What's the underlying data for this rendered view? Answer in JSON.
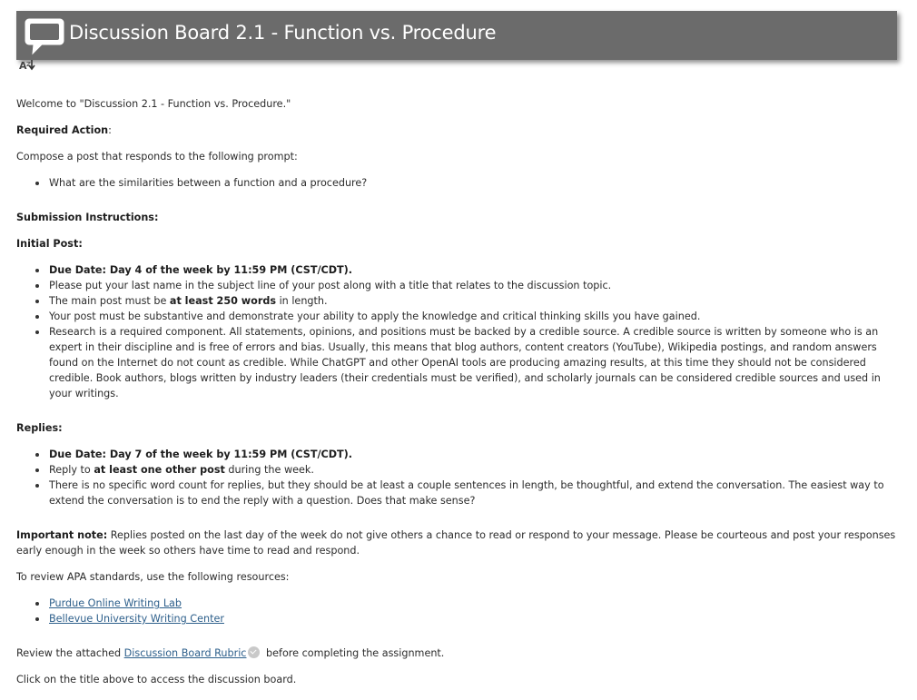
{
  "header": {
    "title": "Discussion Board 2.1 - Function vs. Procedure",
    "icon": "speech-bubble-icon"
  },
  "toolbar": {
    "sort_icon": "sort-az-icon"
  },
  "body": {
    "welcome": "Welcome to \"Discussion 2.1 - Function vs. Procedure.\"",
    "required_action_label": "Required Action",
    "required_action_colon": ":",
    "compose": "Compose a post that responds to the following prompt:",
    "prompt_items": [
      "What are the similarities between a function and a procedure?"
    ],
    "submission_heading": "Submission Instructions:",
    "initial_post_heading": "Initial Post:",
    "initial_items": {
      "due": "Due Date: Day 4 of the week by 11:59 PM (CST/CDT).",
      "subject": "Please put your last name in the subject line of your post along with a title that relates to the discussion topic.",
      "length_pre": "The main post must be ",
      "length_bold": "at least 250 words",
      "length_post": " in length.",
      "substantive": "Your post must be substantive and demonstrate your ability to apply the knowledge and critical thinking skills you have gained.",
      "research": "Research is a required component.  All statements, opinions, and positions must be backed by a credible source.  A credible source is written by someone who is an expert in their discipline and is free of errors and bias.  Usually, this means that blog authors, content creators (YouTube), Wikipedia postings, and random answers found on the Internet do not count as credible.  While ChatGPT and other OpenAI tools are producing amazing results, at this time they should not be considered credible.  Book authors, blogs written by industry leaders (their credentials must be verified), and scholarly journals can be considered credible sources and used in your writings."
    },
    "replies_heading": "Replies:",
    "reply_items": {
      "due": "Due Date: Day 7 of the week by 11:59 PM (CST/CDT).",
      "reply_pre": "Reply to ",
      "reply_bold": "at least one other post",
      "reply_post": " during the week.",
      "word_count": "There is no specific word count for replies, but they should be at least a couple sentences in length, be thoughtful, and extend the conversation.  The easiest way to extend the conversation is to end the reply with a question.  Does that make sense?"
    },
    "important_label": "Important note:",
    "important_text": "  Replies posted on the last day of the week do not give others a chance to read or respond to your message.  Please be courteous and post your responses early enough in the week so others have time to read and respond.",
    "apa_intro": "To review APA standards, use the following resources:",
    "links": [
      "Purdue Online Writing Lab",
      "Bellevue University Writing Center"
    ],
    "rubric_pre": "Review the attached ",
    "rubric_link": "Discussion Board Rubric",
    "rubric_post": " before completing the assignment.",
    "click_title": "Click on the title above to access the discussion board."
  },
  "colors": {
    "header_bg": "#6b6b6b",
    "link": "#2d5f8b",
    "text": "#2b2b2b"
  }
}
